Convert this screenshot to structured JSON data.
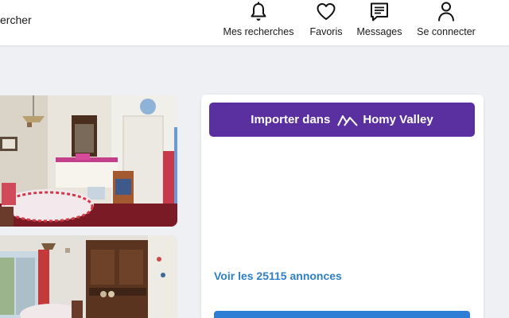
{
  "header": {
    "search_label": "ercher",
    "nav": [
      {
        "label": "Mes recherches",
        "icon": "bell-icon"
      },
      {
        "label": "Favoris",
        "icon": "heart-icon"
      },
      {
        "label": "Messages",
        "icon": "message-icon"
      },
      {
        "label": "Se connecter",
        "icon": "user-icon"
      }
    ]
  },
  "listing": {
    "import_button": {
      "prefix": "Importer dans",
      "brand": "Homy Valley",
      "logo_icon": "homy-valley-logo-icon",
      "color": "#5a2fa0"
    },
    "see_all_link": "Voir les 25115 annonces",
    "link_color": "#2e7fc8",
    "primary_color": "#2f7ed6"
  }
}
